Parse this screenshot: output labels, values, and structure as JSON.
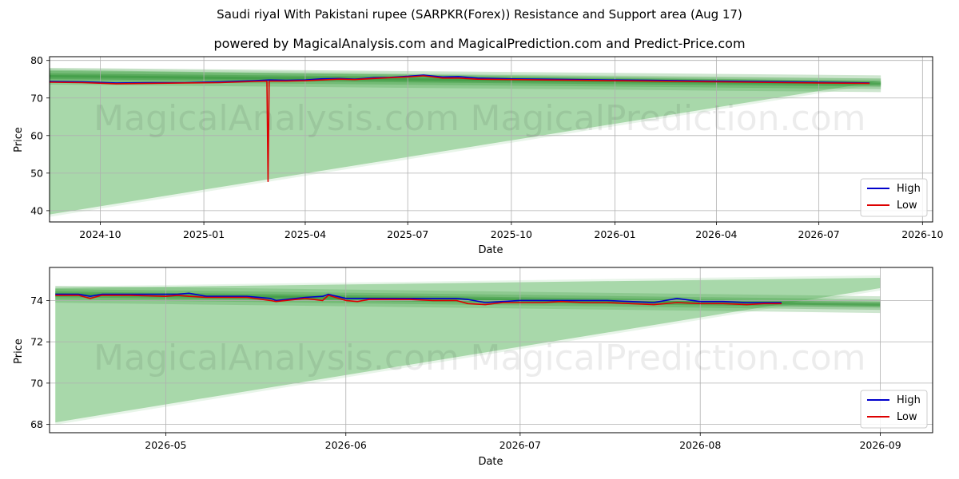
{
  "title": "Saudi riyal With Pakistani rupee (SARPKR(Forex)) Resistance and Support area (Aug 17)",
  "subtitle": "powered by MagicalAnalysis.com and MagicalPrediction.com and Predict-Price.com",
  "watermarks": [
    "MagicalAnalysis.com",
    "MagicalPrediction.com"
  ],
  "colors": {
    "high": "#0000cc",
    "low": "#dd0000",
    "band_light": "#a5d6a7",
    "band_dark": "#3a9a3f",
    "grid": "#b0b0b0"
  },
  "chart_data": [
    {
      "type": "line",
      "xlabel": "Date",
      "ylabel": "Price",
      "xlim": [
        "2024-08-17",
        "2026-10-10"
      ],
      "ylim": [
        37,
        81
      ],
      "x_ticks": [
        "2024-10",
        "2025-01",
        "2025-04",
        "2025-07",
        "2025-10",
        "2026-01",
        "2026-04",
        "2026-07",
        "2026-10"
      ],
      "y_ticks": [
        40,
        50,
        60,
        70,
        80
      ],
      "grid": true,
      "legend_position": "lower-right",
      "legend": [
        "High",
        "Low"
      ],
      "support_fan": {
        "start": "2024-08-17",
        "end": "2026-08-25",
        "top_start": 77.5,
        "top_end": 74.5,
        "bottom_start": 39,
        "bottom_end": 74.5
      },
      "resistance_band": {
        "start": "2024-08-17",
        "end": "2026-08-25",
        "from": 75.8,
        "to": 73.8
      },
      "series": [
        {
          "name": "High",
          "x": [
            "2024-08-17",
            "2024-09-15",
            "2024-10-15",
            "2024-11-15",
            "2024-12-15",
            "2025-01-15",
            "2025-02-15",
            "2025-02-28",
            "2025-03-15",
            "2025-04-01",
            "2025-04-15",
            "2025-05-01",
            "2025-05-15",
            "2025-06-01",
            "2025-06-15",
            "2025-07-01",
            "2025-07-15",
            "2025-08-01",
            "2025-08-15",
            "2025-09-01",
            "2025-10-01",
            "2025-11-01",
            "2025-12-01",
            "2026-01-01",
            "2026-02-01",
            "2026-03-01",
            "2026-04-01",
            "2026-05-01",
            "2026-06-01",
            "2026-07-01",
            "2026-08-15"
          ],
          "values": [
            74.4,
            74.3,
            74.0,
            74.1,
            74.1,
            74.3,
            74.6,
            74.8,
            74.7,
            74.8,
            75.1,
            75.2,
            75.0,
            75.4,
            75.5,
            75.8,
            76.1,
            75.6,
            75.7,
            75.3,
            75.1,
            75.0,
            74.9,
            74.8,
            74.7,
            74.6,
            74.5,
            74.4,
            74.3,
            74.2,
            74.0
          ]
        },
        {
          "name": "Low",
          "x": [
            "2024-08-17",
            "2024-09-15",
            "2024-10-15",
            "2024-11-15",
            "2024-12-15",
            "2025-01-15",
            "2025-02-15",
            "2025-02-26",
            "2025-02-27",
            "2025-02-28",
            "2025-03-15",
            "2025-04-01",
            "2025-04-15",
            "2025-05-01",
            "2025-05-15",
            "2025-06-01",
            "2025-06-15",
            "2025-07-01",
            "2025-07-15",
            "2025-08-01",
            "2025-08-15",
            "2025-09-01",
            "2025-10-01",
            "2025-11-01",
            "2025-12-01",
            "2026-01-01",
            "2026-02-01",
            "2026-03-01",
            "2026-04-01",
            "2026-05-01",
            "2026-06-01",
            "2026-07-01",
            "2026-08-15"
          ],
          "values": [
            74.2,
            74.1,
            73.8,
            73.9,
            74.0,
            74.1,
            74.4,
            74.5,
            47.8,
            74.5,
            74.5,
            74.6,
            74.8,
            75.0,
            74.9,
            75.2,
            75.4,
            75.6,
            75.9,
            75.3,
            75.3,
            75.0,
            74.9,
            74.8,
            74.7,
            74.6,
            74.5,
            74.4,
            74.3,
            74.2,
            74.1,
            74.0,
            73.9
          ]
        }
      ]
    },
    {
      "type": "line",
      "xlabel": "Date",
      "ylabel": "Price",
      "xlim": [
        "2026-04-11",
        "2026-09-10"
      ],
      "ylim": [
        67.6,
        75.6
      ],
      "x_ticks": [
        "2026-05",
        "2026-06",
        "2026-07",
        "2026-08",
        "2026-09"
      ],
      "y_ticks": [
        68,
        70,
        72,
        74
      ],
      "grid": true,
      "legend_position": "lower-right",
      "legend": [
        "High",
        "Low"
      ],
      "support_fan": {
        "start": "2026-04-12",
        "end": "2026-09-01",
        "top_start": 74.6,
        "top_end": 75.1,
        "bottom_start": 68.1,
        "bottom_end": 74.6
      },
      "resistance_band": {
        "start": "2026-04-12",
        "end": "2026-09-01",
        "from": 74.3,
        "to": 73.8
      },
      "series": [
        {
          "name": "High",
          "x": [
            "2026-04-12",
            "2026-04-16",
            "2026-04-18",
            "2026-04-20",
            "2026-04-25",
            "2026-05-01",
            "2026-05-03",
            "2026-05-05",
            "2026-05-08",
            "2026-05-12",
            "2026-05-15",
            "2026-05-19",
            "2026-05-20",
            "2026-05-25",
            "2026-05-28",
            "2026-05-29",
            "2026-06-01",
            "2026-06-03",
            "2026-06-05",
            "2026-06-08",
            "2026-06-12",
            "2026-06-16",
            "2026-06-20",
            "2026-06-22",
            "2026-06-25",
            "2026-06-28",
            "2026-07-01",
            "2026-07-05",
            "2026-07-08",
            "2026-07-12",
            "2026-07-16",
            "2026-07-20",
            "2026-07-24",
            "2026-07-28",
            "2026-08-01",
            "2026-08-05",
            "2026-08-09",
            "2026-08-12",
            "2026-08-15"
          ],
          "values": [
            74.3,
            74.3,
            74.2,
            74.3,
            74.3,
            74.3,
            74.3,
            74.35,
            74.2,
            74.2,
            74.2,
            74.1,
            74.0,
            74.15,
            74.2,
            74.3,
            74.1,
            74.1,
            74.1,
            74.1,
            74.1,
            74.1,
            74.1,
            74.05,
            73.9,
            73.95,
            74.0,
            74.0,
            74.0,
            74.0,
            74.0,
            73.95,
            73.9,
            74.1,
            73.95,
            73.95,
            73.9,
            73.9,
            73.9
          ]
        },
        {
          "name": "Low",
          "x": [
            "2026-04-12",
            "2026-04-16",
            "2026-04-18",
            "2026-04-20",
            "2026-04-25",
            "2026-05-01",
            "2026-05-03",
            "2026-05-05",
            "2026-05-08",
            "2026-05-12",
            "2026-05-15",
            "2026-05-19",
            "2026-05-20",
            "2026-05-25",
            "2026-05-28",
            "2026-05-29",
            "2026-06-01",
            "2026-06-03",
            "2026-06-05",
            "2026-06-08",
            "2026-06-12",
            "2026-06-16",
            "2026-06-20",
            "2026-06-22",
            "2026-06-25",
            "2026-06-28",
            "2026-07-01",
            "2026-07-05",
            "2026-07-08",
            "2026-07-12",
            "2026-07-16",
            "2026-07-20",
            "2026-07-24",
            "2026-07-28",
            "2026-08-01",
            "2026-08-05",
            "2026-08-09",
            "2026-08-12",
            "2026-08-15"
          ],
          "values": [
            74.25,
            74.25,
            74.1,
            74.25,
            74.25,
            74.2,
            74.25,
            74.2,
            74.15,
            74.15,
            74.15,
            74.0,
            73.95,
            74.1,
            74.0,
            74.25,
            74.0,
            73.95,
            74.05,
            74.05,
            74.05,
            74.0,
            74.0,
            73.85,
            73.8,
            73.9,
            73.9,
            73.9,
            73.95,
            73.9,
            73.9,
            73.85,
            73.8,
            73.9,
            73.85,
            73.85,
            73.8,
            73.85,
            73.85
          ]
        }
      ]
    }
  ]
}
